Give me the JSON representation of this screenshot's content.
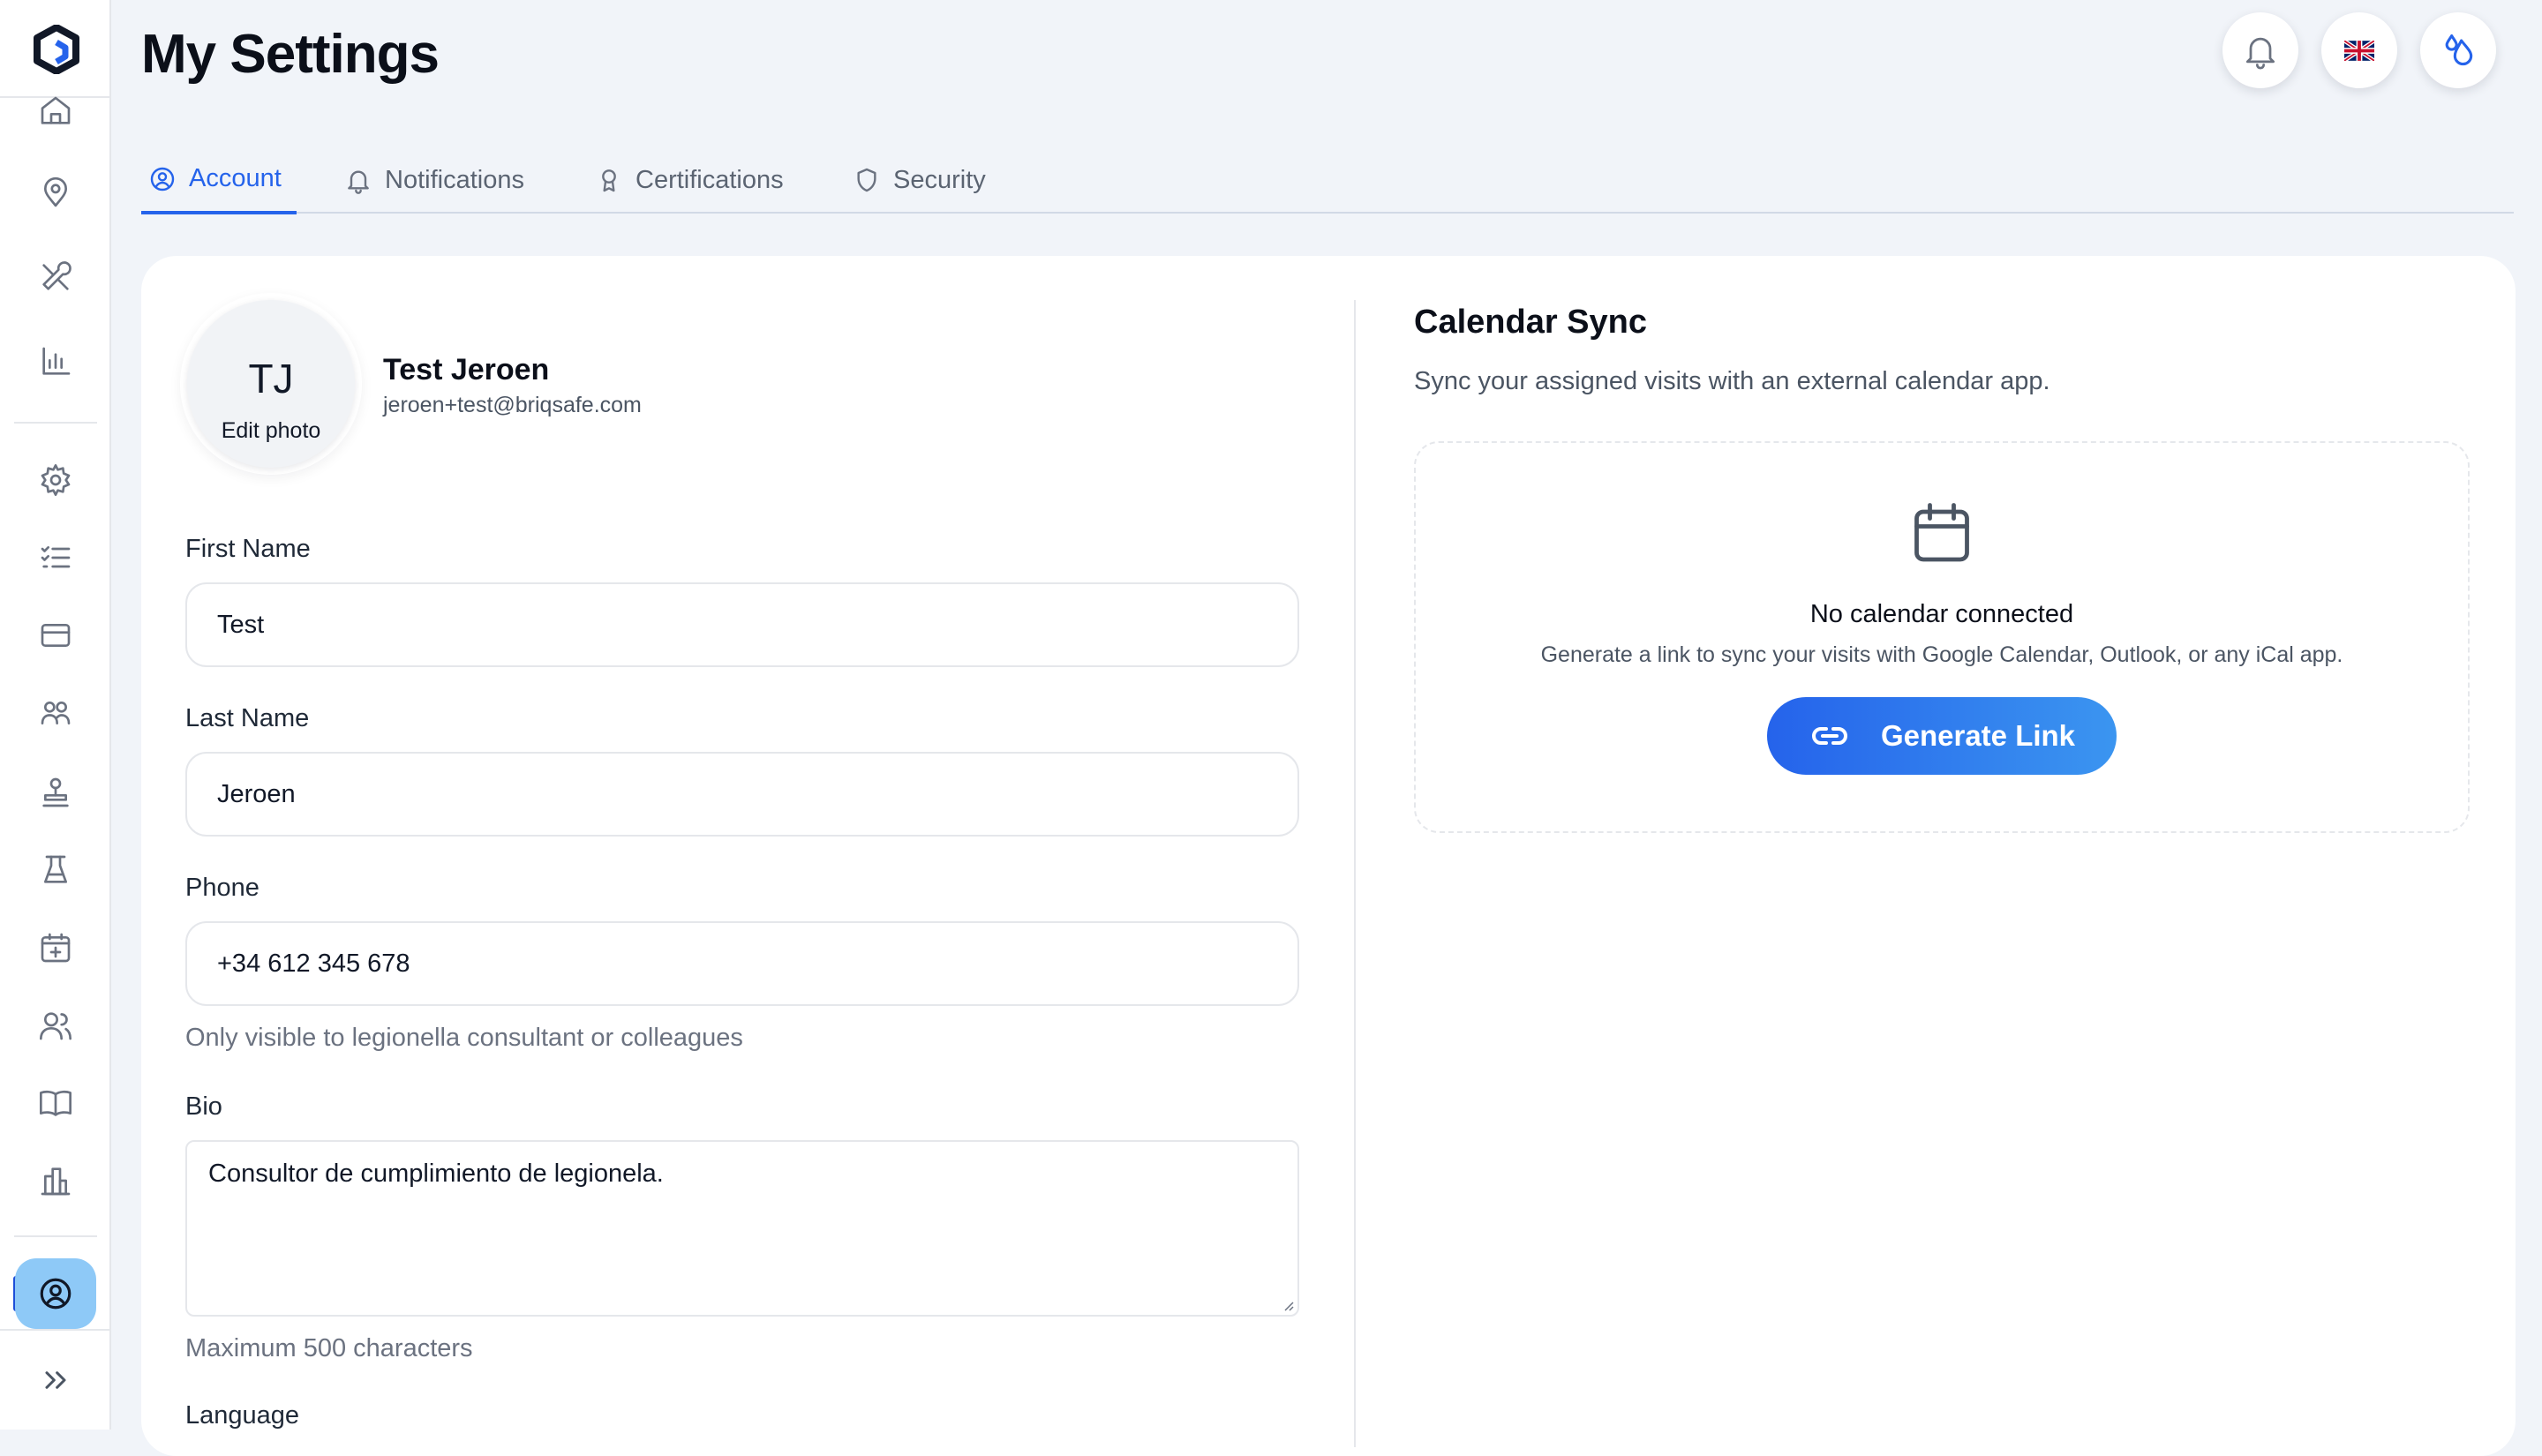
{
  "page": {
    "title": "My Settings"
  },
  "header": {
    "notifications_icon": "bell-icon",
    "language_flag": "🇬🇧",
    "brand_icon": "water-drops-icon"
  },
  "tabs": [
    {
      "label": "Account",
      "icon": "user-circle-icon",
      "active": true
    },
    {
      "label": "Notifications",
      "icon": "bell-icon",
      "active": false
    },
    {
      "label": "Certifications",
      "icon": "award-icon",
      "active": false
    },
    {
      "label": "Security",
      "icon": "shield-icon",
      "active": false
    }
  ],
  "profile": {
    "initials": "TJ",
    "edit_photo": "Edit photo",
    "name": "Test Jeroen",
    "email": "jeroen+test@briqsafe.com"
  },
  "form": {
    "first_name": {
      "label": "First Name",
      "value": "Test"
    },
    "last_name": {
      "label": "Last Name",
      "value": "Jeroen"
    },
    "phone": {
      "label": "Phone",
      "value": "+34 612 345 678",
      "hint": "Only visible to legionella consultant or colleagues"
    },
    "bio": {
      "label": "Bio",
      "value": "Consultor de cumplimiento de legionela.",
      "hint": "Maximum 500 characters"
    },
    "language": {
      "label": "Language"
    }
  },
  "calendar": {
    "title": "Calendar Sync",
    "subtitle": "Sync your assigned visits with an external calendar app.",
    "empty_title": "No calendar connected",
    "empty_desc": "Generate a link to sync your visits with Google Calendar, Outlook, or any iCal app.",
    "button": "Generate Link"
  },
  "colors": {
    "accent": "#2563eb",
    "sidebar_active": "#8ec9f7",
    "background": "#f1f4f9"
  }
}
